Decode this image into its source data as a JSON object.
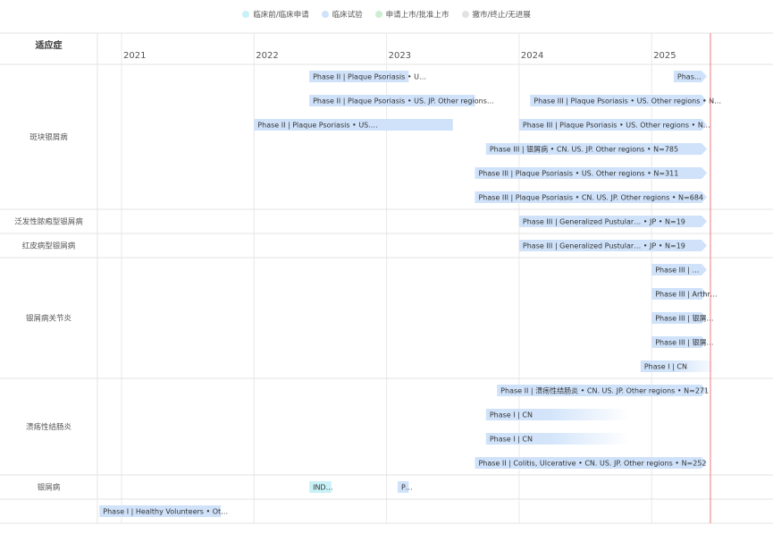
{
  "legend": [
    {
      "label": "临床前/临床申请",
      "color": "#c8f2f7"
    },
    {
      "label": "临床试验",
      "color": "#cfe2fa"
    },
    {
      "label": "申请上市/批准上市",
      "color": "#cdeed0"
    },
    {
      "label": "撤市/终止/无进展",
      "color": "#e2e2e2"
    }
  ],
  "chart_data": {
    "type": "gantt",
    "header_label": "适应症",
    "x_ticks": [
      "2021",
      "2022",
      "2023",
      "2024",
      "2025"
    ],
    "x_range": [
      "2020-10",
      "2025-07"
    ],
    "today_marker": "2025-06",
    "colors": {
      "clinical": "#cfe2fa",
      "ind": "#c8f2f7",
      "grid": "#e6e6e6",
      "today": "#f0767a"
    },
    "groups": [
      {
        "label": "斑块银屑病",
        "rows": 6
      },
      {
        "label": "泛发性脓疱型银屑病",
        "rows": 1
      },
      {
        "label": "红皮病型银屑病",
        "rows": 1
      },
      {
        "label": "银屑病关节炎",
        "rows": 5
      },
      {
        "label": "溃疡性结肠炎",
        "rows": 4
      },
      {
        "label": "银屑病",
        "rows": 1
      },
      {
        "label": "",
        "rows": 1
      }
    ],
    "bars": [
      {
        "row": 0,
        "start": "2022-06",
        "end": "2023-03",
        "label": "Phase II | Plaque Psoriasis • U…",
        "phase": "clinical",
        "arrow": false
      },
      {
        "row": 0,
        "start": "2025-03",
        "end": "2025-06",
        "label": "Phas…",
        "phase": "clinical",
        "arrow": true
      },
      {
        "row": 1,
        "start": "2022-06",
        "end": "2023-09",
        "label": "Phase II | Plaque Psoriasis • US. JP. Other regions…",
        "phase": "clinical",
        "arrow": false
      },
      {
        "row": 1,
        "start": "2024-02",
        "end": "2025-06",
        "label": "Phase III | Plaque Psoriasis • US. Other regions • N…",
        "phase": "clinical",
        "arrow": true
      },
      {
        "row": 2,
        "start": "2022-01",
        "end": "2023-07",
        "label": "Phase II | Plaque Psoriasis • US.…",
        "phase": "clinical",
        "arrow": false
      },
      {
        "row": 2,
        "start": "2024-01",
        "end": "2025-06",
        "label": "Phase III | Plaque Psoriasis • US. Other regions • N…",
        "phase": "clinical",
        "arrow": true
      },
      {
        "row": 3,
        "start": "2023-10",
        "end": "2025-06",
        "label": "Phase III | 银屑病 • CN. US. JP. Other regions • N=785",
        "phase": "clinical",
        "arrow": true
      },
      {
        "row": 4,
        "start": "2023-09",
        "end": "2025-06",
        "label": "Phase III | Plaque Psoriasis • US. Other regions • N=311",
        "phase": "clinical",
        "arrow": true
      },
      {
        "row": 5,
        "start": "2023-09",
        "end": "2025-06",
        "label": "Phase III | Plaque Psoriasis • CN. US. JP. Other regions • N=684",
        "phase": "clinical",
        "arrow": true
      },
      {
        "row": 6,
        "start": "2024-01",
        "end": "2025-06",
        "label": "Phase III | Generalized Pustular… • JP • N=19",
        "phase": "clinical",
        "arrow": true
      },
      {
        "row": 7,
        "start": "2024-01",
        "end": "2025-06",
        "label": "Phase III | Generalized Pustular… • JP • N=19",
        "phase": "clinical",
        "arrow": true
      },
      {
        "row": 8,
        "start": "2025-01",
        "end": "2025-06",
        "label": "Phase III | …",
        "phase": "clinical",
        "arrow": true
      },
      {
        "row": 9,
        "start": "2025-01",
        "end": "2025-06",
        "label": "Phase III | Arthr…",
        "phase": "clinical",
        "arrow": true
      },
      {
        "row": 10,
        "start": "2025-01",
        "end": "2025-06",
        "label": "Phase III | 银屑…",
        "phase": "clinical",
        "arrow": true
      },
      {
        "row": 11,
        "start": "2025-01",
        "end": "2025-06",
        "label": "Phase III | 银屑…",
        "phase": "clinical",
        "arrow": true
      },
      {
        "row": 12,
        "start": "2024-12",
        "end": "2025-07",
        "label": "Phase I | CN",
        "phase": "clinical",
        "arrow": false,
        "fade": true
      },
      {
        "row": 13,
        "start": "2023-11",
        "end": "2025-06",
        "label": "Phase II | 溃疡性结肠炎 • CN. US. JP. Other regions • N=271",
        "phase": "clinical",
        "arrow": true
      },
      {
        "row": 14,
        "start": "2023-10",
        "end": "2024-11",
        "label": "Phase I | CN",
        "phase": "clinical",
        "arrow": false,
        "fade": true
      },
      {
        "row": 15,
        "start": "2023-10",
        "end": "2024-11",
        "label": "Phase I | CN",
        "phase": "clinical",
        "arrow": false,
        "fade": true
      },
      {
        "row": 16,
        "start": "2023-09",
        "end": "2025-06",
        "label": "Phase II | Colitis, Ulcerative • CN. US. JP. Other regions • N=252",
        "phase": "clinical",
        "arrow": true
      },
      {
        "row": 17,
        "start": "2022-06",
        "end": "2022-08",
        "label": "IND…",
        "phase": "ind",
        "arrow": false
      },
      {
        "row": 17,
        "start": "2023-02",
        "end": "2023-03",
        "label": "P…",
        "phase": "clinical",
        "arrow": false
      },
      {
        "row": 18,
        "start": "2020-11",
        "end": "2021-10",
        "label": "Phase I | Healthy Volunteers • Ot…",
        "phase": "clinical",
        "arrow": false
      }
    ]
  }
}
